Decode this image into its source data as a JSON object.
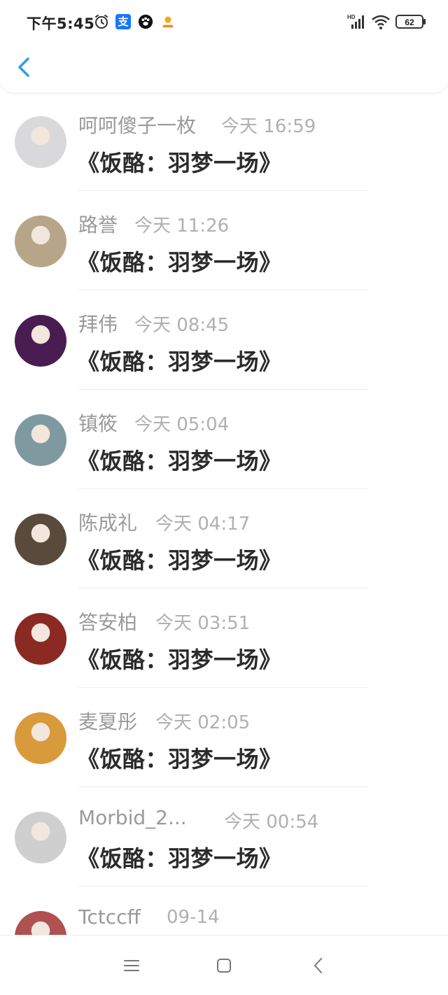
{
  "status_bar": {
    "time": "下午5:45",
    "alipay_glyph": "支",
    "network_label": "HD",
    "battery": "62",
    "icons": [
      "alarm-icon",
      "alipay-icon",
      "paw-icon",
      "sun-icon",
      "signal-icon",
      "wifi-icon",
      "battery-icon"
    ]
  },
  "header": {
    "back_icon": "chevron-left-icon",
    "accent_color": "#2f9bf0"
  },
  "comments": [
    {
      "user": "呵呵傻子一枚",
      "time": "今天 16:59",
      "text": "《饭酪：羽梦一场》",
      "avatar_color": "#d9d9dc"
    },
    {
      "user": "路誉",
      "time": "今天 11:26",
      "text": "《饭酪：羽梦一场》",
      "avatar_color": "#b7a58a"
    },
    {
      "user": "拜伟",
      "time": "今天 08:45",
      "text": "《饭酪：羽梦一场》",
      "avatar_color": "#4a1d52"
    },
    {
      "user": "镇筱",
      "time": "今天 05:04",
      "text": "《饭酪：羽梦一场》",
      "avatar_color": "#7e9aa0"
    },
    {
      "user": "陈成礼",
      "time": "今天 04:17",
      "text": "《饭酪：羽梦一场》",
      "avatar_color": "#5a4a3c"
    },
    {
      "user": "答安柏",
      "time": "今天 03:51",
      "text": "《饭酪：羽梦一场》",
      "avatar_color": "#8a2a22"
    },
    {
      "user": "麦夏彤",
      "time": "今天 02:05",
      "text": "《饭酪：羽梦一场》",
      "avatar_color": "#d89a3a"
    },
    {
      "user": "Morbid_2...",
      "time": "今天 00:54",
      "text": "《饭酪：羽梦一场》",
      "avatar_color": "#cfcfcf"
    },
    {
      "user": "Tctccff",
      "time": "09-14",
      "text": "",
      "avatar_color": "#b05050"
    }
  ],
  "nav_bar": {
    "icons": [
      "menu-icon",
      "home-icon",
      "back-icon"
    ]
  }
}
